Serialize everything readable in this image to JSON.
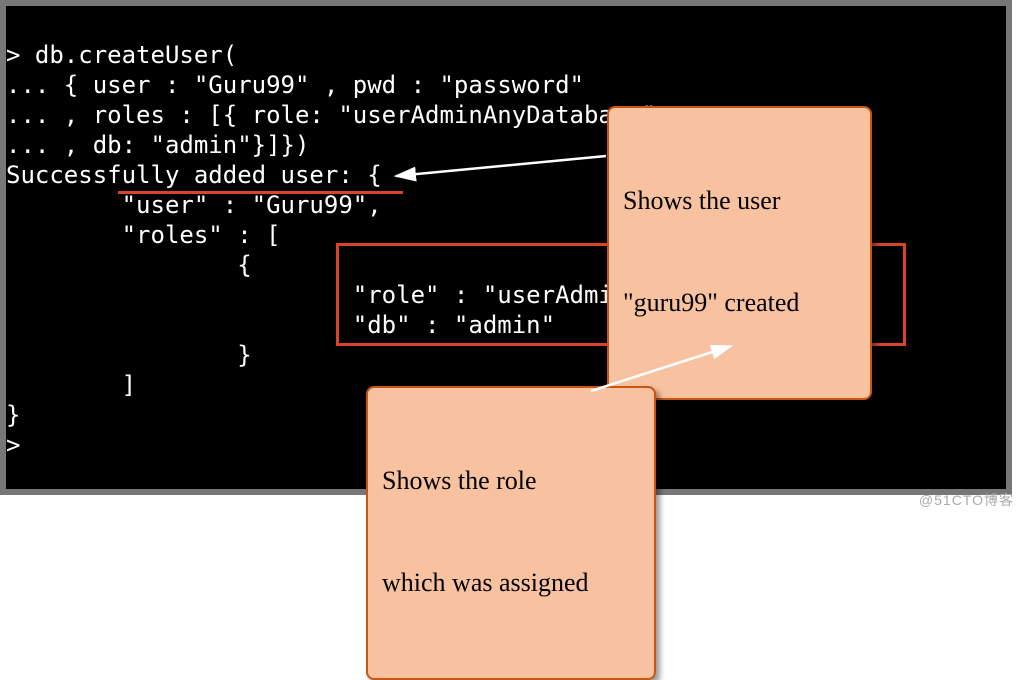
{
  "terminal": {
    "l1": "> db.createUser(",
    "l2": "... { user : \"Guru99\" , pwd : \"password\"",
    "l3": "... , roles : [{ role: \"userAdminAnyDatabase\"",
    "l4": "... , db: \"admin\"}]})",
    "l5": "Successfully added user: {",
    "l6": "        \"user\" : \"Guru99\",",
    "l7": "        \"roles\" : [",
    "l8": "                {",
    "l9": "                        \"role\" : \"userAdminAnyDatabase\",",
    "l10": "                        \"db\" : \"admin\"",
    "l11": "                }",
    "l12": "        ]",
    "l13": "}",
    "l14": ">"
  },
  "callouts": {
    "user": {
      "line1": "Shows the user",
      "line2": "\"guru99\" created"
    },
    "role": {
      "line1": "Shows the role",
      "line2": "which was assigned"
    }
  },
  "watermark": "@51CTO博客"
}
